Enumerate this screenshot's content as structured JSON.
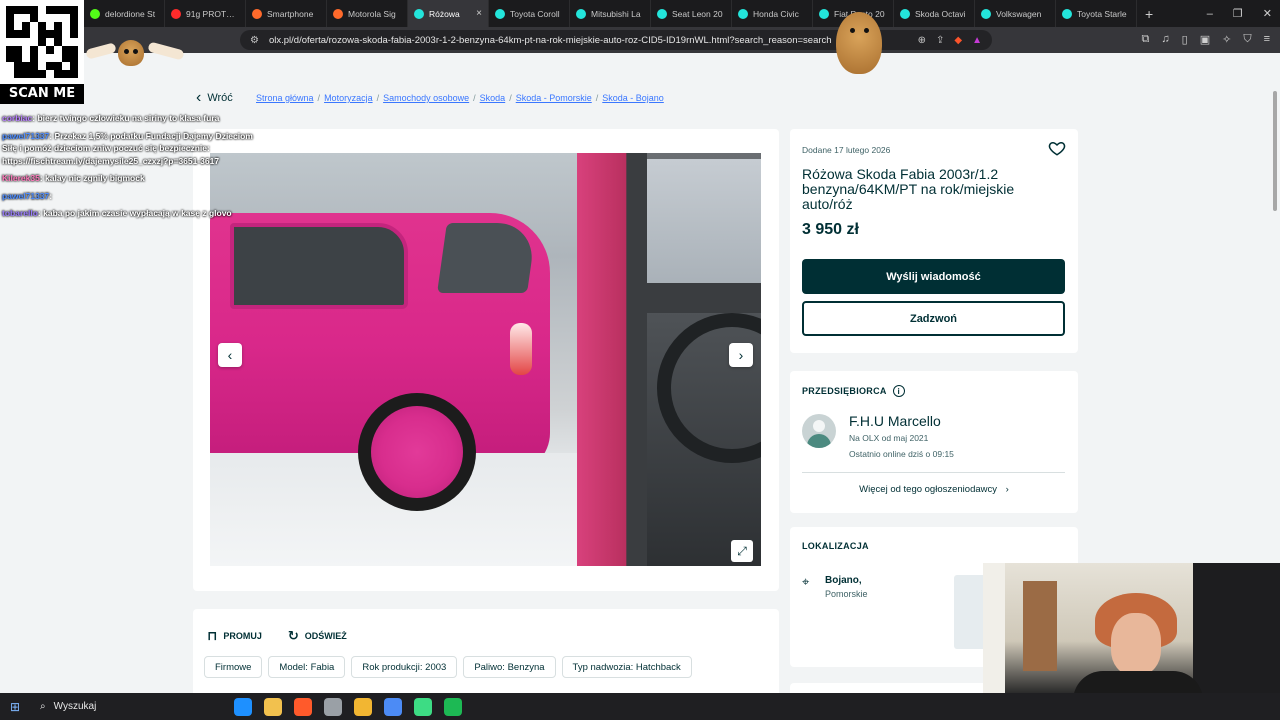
{
  "browser": {
    "tabs": [
      {
        "title": "delordione St",
        "color": "#53fc18"
      },
      {
        "title": "91g PROTEIN",
        "color": "#ff2b2b"
      },
      {
        "title": "Smartphone",
        "color": "#ff6a2b"
      },
      {
        "title": "Motorola Sig",
        "color": "#ff6a2b"
      },
      {
        "title": "Różowa",
        "color": "#23e5db",
        "active": true
      },
      {
        "title": "Toyota Coroll",
        "color": "#23e5db"
      },
      {
        "title": "Mitsubishi La",
        "color": "#23e5db"
      },
      {
        "title": "Seat Leon 20",
        "color": "#23e5db"
      },
      {
        "title": "Honda Civic",
        "color": "#23e5db"
      },
      {
        "title": "Fiat Punto 20",
        "color": "#23e5db"
      },
      {
        "title": "Skoda Octavi",
        "color": "#23e5db"
      },
      {
        "title": "Volkswagen",
        "color": "#23e5db"
      },
      {
        "title": "Toyota Starle",
        "color": "#23e5db"
      }
    ],
    "new_tab": "+",
    "close_glyph": "×",
    "url": "olx.pl/d/oferta/rozowa-skoda-fabia-2003r-1-2-benzyna-64km-pt-na-rok-miejskie-auto-roz-CID5-ID19rnWL.html?search_reason=search",
    "window_controls": [
      "–",
      "❐",
      "✕"
    ]
  },
  "overlay": {
    "scan_label": "SCAN ME",
    "chat": [
      {
        "user": "corbiac",
        "text": "bierz twingo czlowieku na siriny to klasa fura",
        "color_class": "c1"
      },
      {
        "user": "pawel71337",
        "text": "Przekaz 1,5% podatku Fundacji Dajemy Dzieciom Siłę i pomóż dzieciom zniw poczuć się bezpiecznie: https://fischtream.ly/dajemysile25_czxzj?p=3651-3617",
        "color_class": "c2"
      },
      {
        "user": "Kilerek35",
        "text": "kalay nic zgnily bigmock",
        "color_class": "c3"
      },
      {
        "user": "pawel71337",
        "text": "",
        "color_class": "c2"
      },
      {
        "user": "tobarello",
        "text": "kaba po jakim czasie wypłacają w kasę z glovo",
        "color_class": "c4"
      }
    ]
  },
  "page": {
    "back_label": "Wróć",
    "breadcrumb": [
      "Strona główna",
      "Motoryzacja",
      "Samochody osobowe",
      "Skoda",
      "Skoda - Pomorskie",
      "Skoda - Bojano"
    ],
    "listing": {
      "added": "Dodane 17 lutego 2026",
      "title": "Różowa Skoda Fabia 2003r/1.2 benzyna/64KM/PT na rok/miejskie auto/róż",
      "price": "3 950 zł",
      "primary_button": "Wyślij wiadomość",
      "secondary_button": "Zadzwoń"
    },
    "seller": {
      "section_label": "PRZEDSIĘBIORCA",
      "name": "F.H.U Marcello",
      "since": "Na OLX od maj 2021",
      "online": "Ostatnio online dziś o 09:15",
      "more_link": "Więcej od tego ogłoszeniodawcy"
    },
    "location": {
      "section_label": "LOKALIZACJA",
      "city": "Bojano,",
      "region": "Pomorskie"
    },
    "actions": {
      "promote": "PROMUJ",
      "refresh": "ODŚWIEŻ"
    },
    "params": [
      "Firmowe",
      "Model: Fabia",
      "Rok produkcji: 2003",
      "Paliwo: Benzyna",
      "Typ nadwozia: Hatchback"
    ]
  },
  "taskbar": {
    "search_placeholder": "Wyszukaj",
    "apps": [
      "#1e90ff",
      "#f2c14e",
      "#ff5a2b",
      "#9aa0a6",
      "#f2b632",
      "#4c8bf5",
      "#3ddc84",
      "#1db954"
    ]
  }
}
